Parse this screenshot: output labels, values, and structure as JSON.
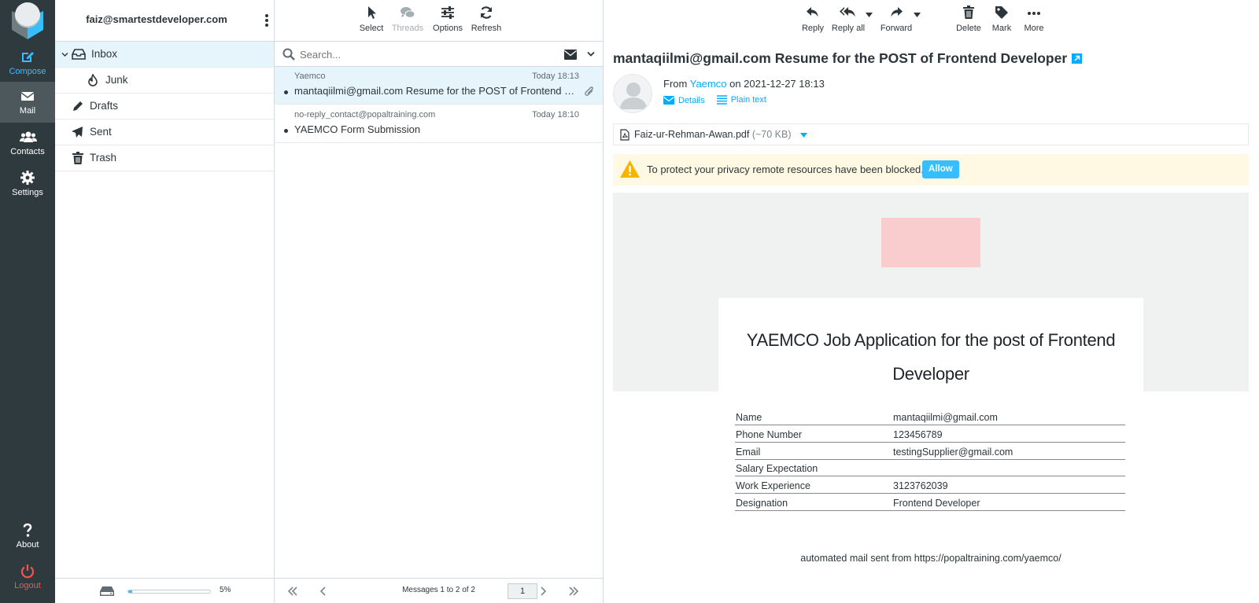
{
  "nav": {
    "compose": "Compose",
    "mail": "Mail",
    "contacts": "Contacts",
    "settings": "Settings",
    "about": "About",
    "logout": "Logout"
  },
  "account": "faiz@smartestdeveloper.com",
  "folders": [
    {
      "name": "Inbox",
      "icon": "inbox-icon",
      "selected": true
    },
    {
      "name": "Junk",
      "icon": "fire-icon"
    },
    {
      "name": "Drafts",
      "icon": "pencil-icon"
    },
    {
      "name": "Sent",
      "icon": "paper-plane-icon"
    },
    {
      "name": "Trash",
      "icon": "trash-icon"
    }
  ],
  "quota": {
    "percent_label": "5%",
    "fraction": 0.05
  },
  "list_toolbar": {
    "select": "Select",
    "threads": "Threads",
    "options": "Options",
    "refresh": "Refresh"
  },
  "search": {
    "placeholder": "Search..."
  },
  "messages": [
    {
      "from": "Yaemco",
      "date": "Today 18:13",
      "subject": "mantaqiilmi@gmail.com Resume for the POST of Frontend Developer",
      "attachment": true,
      "selected": true
    },
    {
      "from": "no-reply_contact@popaltraining.com",
      "date": "Today 18:10",
      "subject": "YAEMCO Form Submission",
      "attachment": false
    }
  ],
  "pager": {
    "count": "Messages 1 to 2 of 2",
    "page": "1"
  },
  "view_toolbar": {
    "reply": "Reply",
    "reply_all": "Reply all",
    "forward": "Forward",
    "delete": "Delete",
    "mark": "Mark",
    "more": "More"
  },
  "message": {
    "subject": "mantaqiilmi@gmail.com Resume for the POST of Frontend Developer",
    "from_prefix": "From",
    "from_name": "Yaemco",
    "date_text": "on 2021-12-27 18:13",
    "details": "Details",
    "plain_text": "Plain text",
    "attachment_name": "Faiz-ur-Rehman-Awan.pdf",
    "attachment_size": "(~70 KB)",
    "privacy_notice": "To protect your privacy remote resources have been blocked.",
    "allow": "Allow",
    "card_title": "YAEMCO Job Application for the post of Frontend Developer",
    "fields": [
      {
        "label": "Name",
        "value": "mantaqiilmi@gmail.com"
      },
      {
        "label": "Phone Number",
        "value": "123456789"
      },
      {
        "label": "Email",
        "value": "testingSupplier@gmail.com"
      },
      {
        "label": "Salary Expectation",
        "value": ""
      },
      {
        "label": "Work Experience",
        "value": "3123762039"
      },
      {
        "label": "Designation",
        "value": "Frontend Developer"
      }
    ],
    "footer": "automated mail sent from https://popaltraining.com/yaemco/"
  },
  "colors": {
    "accent": "#37beff",
    "nav_bg": "#2f3a3f",
    "logout": "#f4564c",
    "selected_row": "#e6f5fc",
    "warning_bg": "#fff8e2"
  }
}
